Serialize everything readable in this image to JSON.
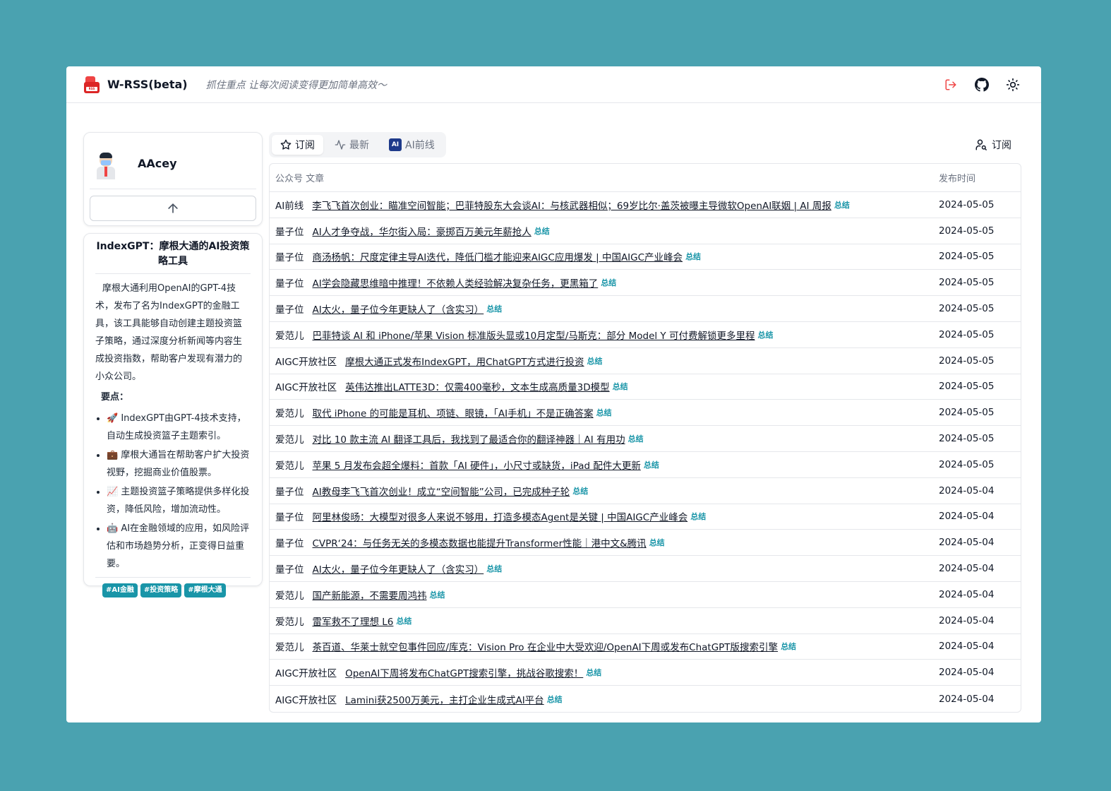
{
  "header": {
    "title": "W-RSS(beta)",
    "tagline": "抓住重点 让每次阅读变得更加简单高效～",
    "logo_text": "RSS"
  },
  "profile": {
    "username": "AAcey"
  },
  "summary": {
    "title": "IndexGPT：摩根大通的AI投资策略工具",
    "body": "摩根大通利用OpenAI的GPT-4技术，发布了名为IndexGPT的金融工具，该工具能够自动创建主题投资篮子策略，通过深度分析新闻等内容生成投资指数，帮助客户发现有潜力的小众公司。",
    "key_label": "要点：",
    "points": [
      "🚀 IndexGPT由GPT-4技术支持，自动生成投资篮子主题索引。",
      "💼 摩根大通旨在帮助客户扩大投资视野，挖掘商业价值股票。",
      "📈 主题投资篮子策略提供多样化投资，降低风险，增加流动性。",
      "🤖 AI在金融领域的应用，如风险评估和市场趋势分析，正变得日益重要。"
    ],
    "tags": [
      "#AI金融",
      "#投资策略",
      "#摩根大通"
    ]
  },
  "tabs": [
    {
      "label": "订阅",
      "icon": "star-icon"
    },
    {
      "label": "最新",
      "icon": "activity-icon"
    },
    {
      "label": "AI前线",
      "icon": "ai-badge-icon"
    }
  ],
  "ai_badge": "AI",
  "subscribe_label": "订阅",
  "table": {
    "col_article": "公众号 文章",
    "col_date": "发布时间",
    "summary_link": "总结",
    "rows": [
      {
        "account": "AI前线",
        "title": "李飞飞首次创业：瞄准空间智能；巴菲特股东大会谈AI：与核武器相似；69岁比尔·盖茨被曝主导微软OpenAI联姻 | AI 周报",
        "date": "2024-05-05"
      },
      {
        "account": "量子位",
        "title": "AI人才争夺战，华尔街入局：豪掷百万美元年薪抢人",
        "date": "2024-05-05"
      },
      {
        "account": "量子位",
        "title": "商汤杨帆：尺度定律主导AI迭代，降低门槛才能迎来AIGC应用爆发 | 中国AIGC产业峰会",
        "date": "2024-05-05"
      },
      {
        "account": "量子位",
        "title": "AI学会隐藏思维暗中推理！不依赖人类经验解决复杂任务，更黑箱了",
        "date": "2024-05-05"
      },
      {
        "account": "量子位",
        "title": "AI太火，量子位今年更缺人了（含实习）",
        "date": "2024-05-05"
      },
      {
        "account": "爱范儿",
        "title": "巴菲特谈 AI 和 iPhone/苹果 Vision 标准版头显或10月定型/马斯克：部分 Model Y 可付费解锁更多里程",
        "date": "2024-05-05"
      },
      {
        "account": "AIGC开放社区",
        "title": "摩根大通正式发布IndexGPT，用ChatGPT方式进行投资",
        "date": "2024-05-05"
      },
      {
        "account": "AIGC开放社区",
        "title": "英伟达推出LATTE3D：仅需400毫秒，文本生成高质量3D模型",
        "date": "2024-05-05"
      },
      {
        "account": "爱范儿",
        "title": "取代 iPhone 的可能是耳机、项链、眼镜，「AI手机」不是正确答案",
        "date": "2024-05-05"
      },
      {
        "account": "爱范儿",
        "title": "对比 10 款主流 AI 翻译工具后，我找到了最适合你的翻译神器｜AI 有用功",
        "date": "2024-05-05"
      },
      {
        "account": "爱范儿",
        "title": "苹果 5 月发布会超全爆料：首款「AI 硬件」，小尺寸或缺货，iPad 配件大更新",
        "date": "2024-05-05"
      },
      {
        "account": "量子位",
        "title": "AI教母李飞飞首次创业！成立“空间智能”公司，已完成种子轮",
        "date": "2024-05-04"
      },
      {
        "account": "量子位",
        "title": "阿里林俊旸：大模型对很多人来说不够用，打造多模态Agent是关键 | 中国AIGC产业峰会",
        "date": "2024-05-04"
      },
      {
        "account": "量子位",
        "title": "CVPR‘24：与任务无关的多模态数据也能提升Transformer性能｜港中文&腾讯",
        "date": "2024-05-04"
      },
      {
        "account": "量子位",
        "title": "AI太火，量子位今年更缺人了（含实习）",
        "date": "2024-05-04"
      },
      {
        "account": "爱范儿",
        "title": "国产新能源，不需要周鸿祎",
        "date": "2024-05-04"
      },
      {
        "account": "爱范儿",
        "title": "雷军救不了理想 L6",
        "date": "2024-05-04"
      },
      {
        "account": "爱范儿",
        "title": "茶百道、华莱士就空包事件回应/库克：Vision Pro 在企业中大受欢迎/OpenAI下周或发布ChatGPT版搜索引擎",
        "date": "2024-05-04"
      },
      {
        "account": "AIGC开放社区",
        "title": "OpenAI下周将发布ChatGPT搜索引擎，挑战谷歌搜索！",
        "date": "2024-05-04"
      },
      {
        "account": "AIGC开放社区",
        "title": "Lamini获2500万美元，主打企业生成式AI平台",
        "date": "2024-05-04"
      }
    ]
  },
  "colors": {
    "background": "#4aa2b0",
    "accent": "#1995a8",
    "logout": "#ef4444"
  }
}
